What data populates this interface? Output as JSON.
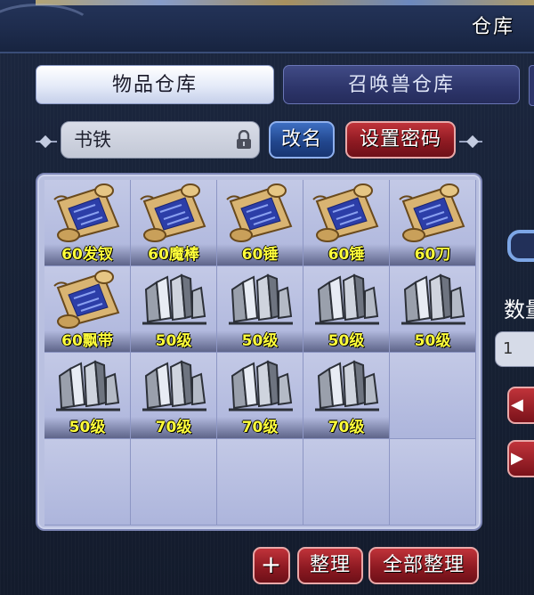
{
  "window": {
    "title": "仓库"
  },
  "tabs": [
    {
      "label": "物品仓库",
      "active": true
    },
    {
      "label": "召唤兽仓库",
      "active": false
    }
  ],
  "warehouse": {
    "name_value": "书铁",
    "rename_label": "改名",
    "set_password_label": "设置密码"
  },
  "grid": {
    "cells": [
      {
        "label": "60发钗",
        "icon": "scroll-icon"
      },
      {
        "label": "60魔棒",
        "icon": "scroll-icon"
      },
      {
        "label": "60锤",
        "icon": "scroll-icon"
      },
      {
        "label": "60锤",
        "icon": "scroll-icon"
      },
      {
        "label": "60刀",
        "icon": "scroll-icon"
      },
      {
        "label": "60飘带",
        "icon": "scroll-icon"
      },
      {
        "label": "50级",
        "icon": "iron-ore-icon"
      },
      {
        "label": "50级",
        "icon": "iron-ore-icon"
      },
      {
        "label": "50级",
        "icon": "iron-ore-icon"
      },
      {
        "label": "50级",
        "icon": "iron-ore-icon"
      },
      {
        "label": "50级",
        "icon": "iron-ore-icon"
      },
      {
        "label": "70级",
        "icon": "iron-ore-icon"
      },
      {
        "label": "70级",
        "icon": "iron-ore-icon"
      },
      {
        "label": "70级",
        "icon": "iron-ore-icon"
      },
      {
        "label": "",
        "icon": ""
      },
      {
        "label": "",
        "icon": ""
      },
      {
        "label": "",
        "icon": ""
      },
      {
        "label": "",
        "icon": ""
      },
      {
        "label": "",
        "icon": ""
      },
      {
        "label": "",
        "icon": ""
      }
    ]
  },
  "bottom": {
    "add_label": "+",
    "sort_label": "整理",
    "sort_all_label": "全部整理"
  },
  "side": {
    "count_label": "数量",
    "count_value": "1"
  },
  "colors": {
    "item_label": "#ffff3a",
    "red_button": "#8e1a22",
    "blue_button": "#22478e",
    "grid_bg": "#b9c0e0"
  }
}
